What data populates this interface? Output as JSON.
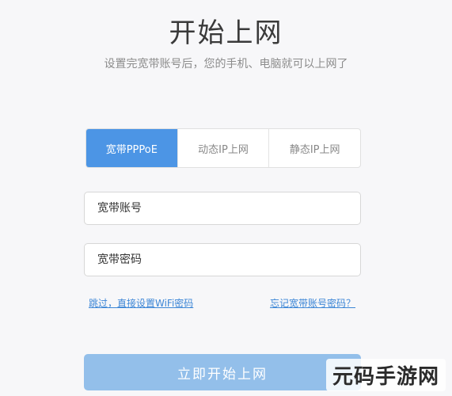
{
  "header": {
    "title": "开始上网",
    "subtitle": "设置完宽带账号后，您的手机、电脑就可以上网了"
  },
  "tabs": [
    {
      "label": "宽带PPPoE",
      "active": true
    },
    {
      "label": "动态IP上网",
      "active": false
    },
    {
      "label": "静态IP上网",
      "active": false
    }
  ],
  "form": {
    "account_placeholder": "宽带账号",
    "password_placeholder": "宽带密码"
  },
  "links": {
    "skip": "跳过，直接设置WiFi密码",
    "forgot": "忘记宽带账号密码？"
  },
  "actions": {
    "start_label": "立即开始上网"
  },
  "watermark": "元码手游网",
  "colors": {
    "accent": "#4c95e5",
    "button": "#93bfea",
    "link": "#3c86d6"
  }
}
